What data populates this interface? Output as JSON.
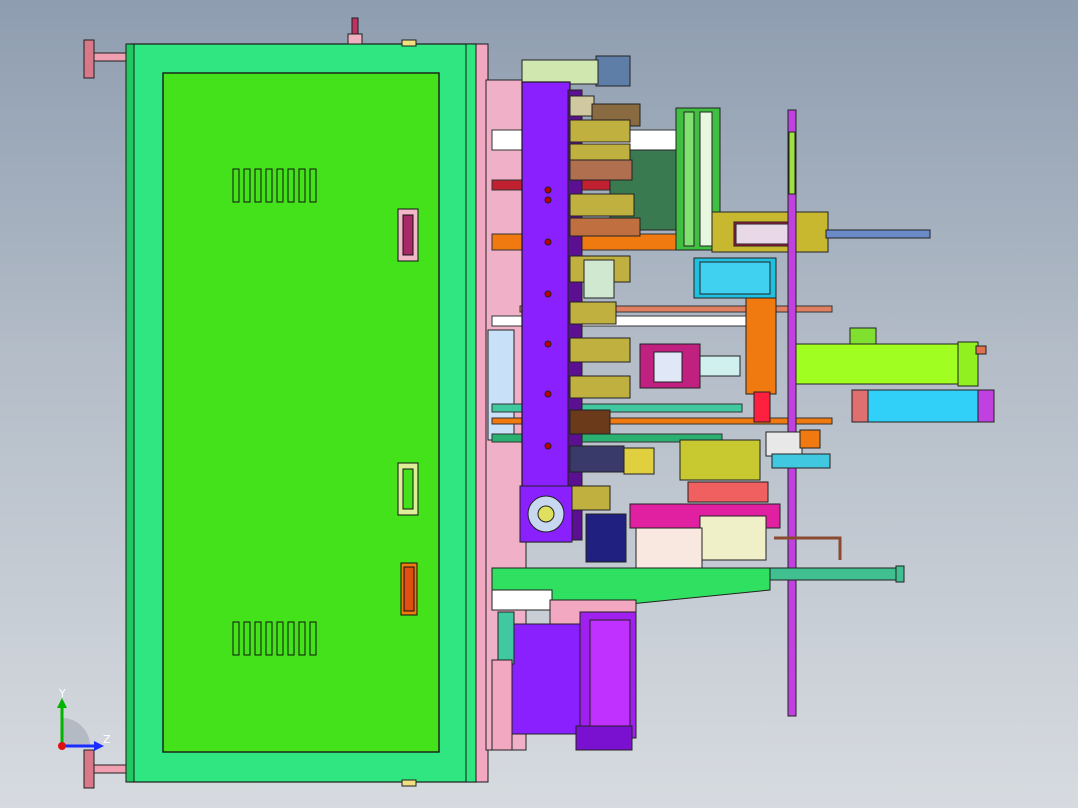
{
  "viewport": {
    "triad": {
      "y_label": "Y",
      "z_label": "Z",
      "colors": {
        "y": "#00b400",
        "z": "#1a2cff",
        "x": "#e01010"
      }
    }
  },
  "colors": {
    "cabinet_green": "#44e21a",
    "frame_green": "#2fe680",
    "violet": "#8b20ff",
    "orange": "#f07a10",
    "cyan": "#20d0f0",
    "pink": "#f2a8c0",
    "olive": "#c8c830",
    "teal": "#40c8a0",
    "lime": "#a0ff20",
    "grey": "#9aa09a"
  }
}
